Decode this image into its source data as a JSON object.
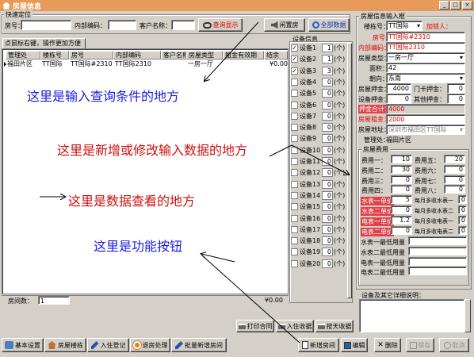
{
  "window": {
    "title": "房屋信息"
  },
  "quick": {
    "group_label": "快速定位",
    "house_label": "房号：",
    "code_label": "内部编码：",
    "customer_label": "客户名称：",
    "query_button": "查询显示",
    "vacant_button": "闲置房",
    "all_button": "全部数据"
  },
  "list": {
    "tab": "点鼠标右键，操作更加方便",
    "columns": [
      "管理处",
      "楼栋号",
      "房号",
      "内部编码",
      "客户名称",
      "房屋类型",
      "租金有效期",
      "结余"
    ],
    "rows": [
      [
        "福田片区",
        "TT国际",
        "TT国际#2310",
        "TT国际2310",
        "",
        "一房一厅",
        "",
        "¥0.00"
      ]
    ],
    "footer_count_label": "房间数：",
    "footer_count": "1",
    "footer_total": "¥0.00"
  },
  "equipment": {
    "label": "设备信息",
    "unit": "(个)",
    "items": [
      {
        "name": "设备1",
        "checked": true,
        "qty": "1"
      },
      {
        "name": "设备2",
        "checked": true,
        "qty": "1"
      },
      {
        "name": "设备3",
        "checked": true,
        "qty": "3"
      },
      {
        "name": "设备4",
        "checked": false,
        "qty": "0"
      },
      {
        "name": "设备5",
        "checked": false,
        "qty": "0"
      },
      {
        "name": "设备6",
        "checked": false,
        "qty": "0"
      },
      {
        "name": "设备7",
        "checked": false,
        "qty": "0"
      },
      {
        "name": "设备8",
        "checked": false,
        "qty": "0"
      },
      {
        "name": "设备9",
        "checked": false,
        "qty": "0"
      },
      {
        "name": "设备10",
        "checked": false,
        "qty": "0"
      },
      {
        "name": "设备11",
        "checked": false,
        "qty": "0"
      },
      {
        "name": "设备12",
        "checked": false,
        "qty": "0"
      },
      {
        "name": "设备13",
        "checked": false,
        "qty": "0"
      },
      {
        "name": "设备14",
        "checked": false,
        "qty": "0"
      },
      {
        "name": "设备15",
        "checked": false,
        "qty": "0"
      },
      {
        "name": "设备16",
        "checked": false,
        "qty": "0"
      },
      {
        "name": "设备17",
        "checked": false,
        "qty": "0"
      },
      {
        "name": "设备18",
        "checked": false,
        "qty": "0"
      },
      {
        "name": "设备19",
        "checked": false,
        "qty": "0"
      },
      {
        "name": "设备20",
        "checked": false,
        "qty": "0"
      }
    ]
  },
  "form": {
    "label": "房屋信息输入框",
    "building_label": "楼栋号：",
    "building_value": "TT国际",
    "lock_label": "加锁人：",
    "house_label": "房号：",
    "house_value": "TT国际#2310",
    "code_label": "内部编码：",
    "code_value": "TT国际2310",
    "type_label": "房屋类型：",
    "type_value": "一房一厅",
    "area_label": "面积：",
    "area_value": "42",
    "orient_label": "朝向：",
    "orient_value": "东南",
    "deposit_label": "房屋押金：",
    "deposit_value": "4000",
    "card_label": "门卡押金：",
    "card_value": "0",
    "equip_dep_label": "设备押金：",
    "equip_dep_value": "0",
    "other_dep_label": "其他押金：",
    "other_dep_value": "0",
    "dep_total_label": "押金合计：",
    "dep_total_value": "4000",
    "rent_label": "房屋租金：",
    "rent_value": "2000",
    "addr_label": "房屋地址：",
    "addr_value": "深圳市福田区TT国际",
    "mgmt_label": "管理处：",
    "mgmt_value": "福田片区"
  },
  "fees": {
    "label": "房屋费用",
    "left": [
      {
        "name": "费用一：",
        "value": "10",
        "red": false
      },
      {
        "name": "费用二：",
        "value": "30",
        "red": false
      },
      {
        "name": "费用三：",
        "value": "0",
        "red": false
      },
      {
        "name": "费用四：",
        "value": "0",
        "red": false
      },
      {
        "name": "水表一单价",
        "value": "5",
        "red": true
      },
      {
        "name": "水表二单价",
        "value": "0",
        "red": true
      },
      {
        "name": "电表一单价",
        "value": "1.2",
        "red": true
      },
      {
        "name": "电表二单价",
        "value": "0",
        "red": true
      }
    ],
    "right": [
      {
        "name": "费用五：",
        "value": "20"
      },
      {
        "name": "费用六：",
        "value": "0"
      },
      {
        "name": "费用七：",
        "value": "0"
      },
      {
        "name": "费用八：",
        "value": "0"
      }
    ],
    "monthly": [
      {
        "name": "每月多收水表一",
        "value": "0"
      },
      {
        "name": "每月多收水表二",
        "value": "0"
      },
      {
        "name": "每月多收电表一",
        "value": "0"
      },
      {
        "name": "每月多收电表二",
        "value": "0"
      }
    ],
    "minimum": [
      "水表一最低用量",
      "水表二最低用量",
      "电表一最低用量",
      "电表二最低用量"
    ],
    "remark_label": "设备及其它详细说明："
  },
  "actions": {
    "print_contract": "打印合同",
    "checkin_receipt": "入住收据",
    "checkout_receipt": "按天收据",
    "basic_settings": "基本设置",
    "house_building": "房屋楼栋",
    "checkin_register": "入住登记",
    "checkout": "退房处理",
    "batch_add": "批量新增房间",
    "add": "新增房间",
    "edit": "编辑",
    "delete": "删除",
    "save": "保存",
    "cancel": "取消"
  },
  "notes": {
    "query": "这里是输入查询条件的地方",
    "edit": "这里是新增或修改输入数据的地方",
    "view": "这里是数据查看的地方",
    "func": "这里是功能按钮"
  },
  "colors": {
    "title": "#e79a5a",
    "note_blue": "#1c1ce0",
    "note_red": "#d01010",
    "label_red": "#e00000"
  }
}
